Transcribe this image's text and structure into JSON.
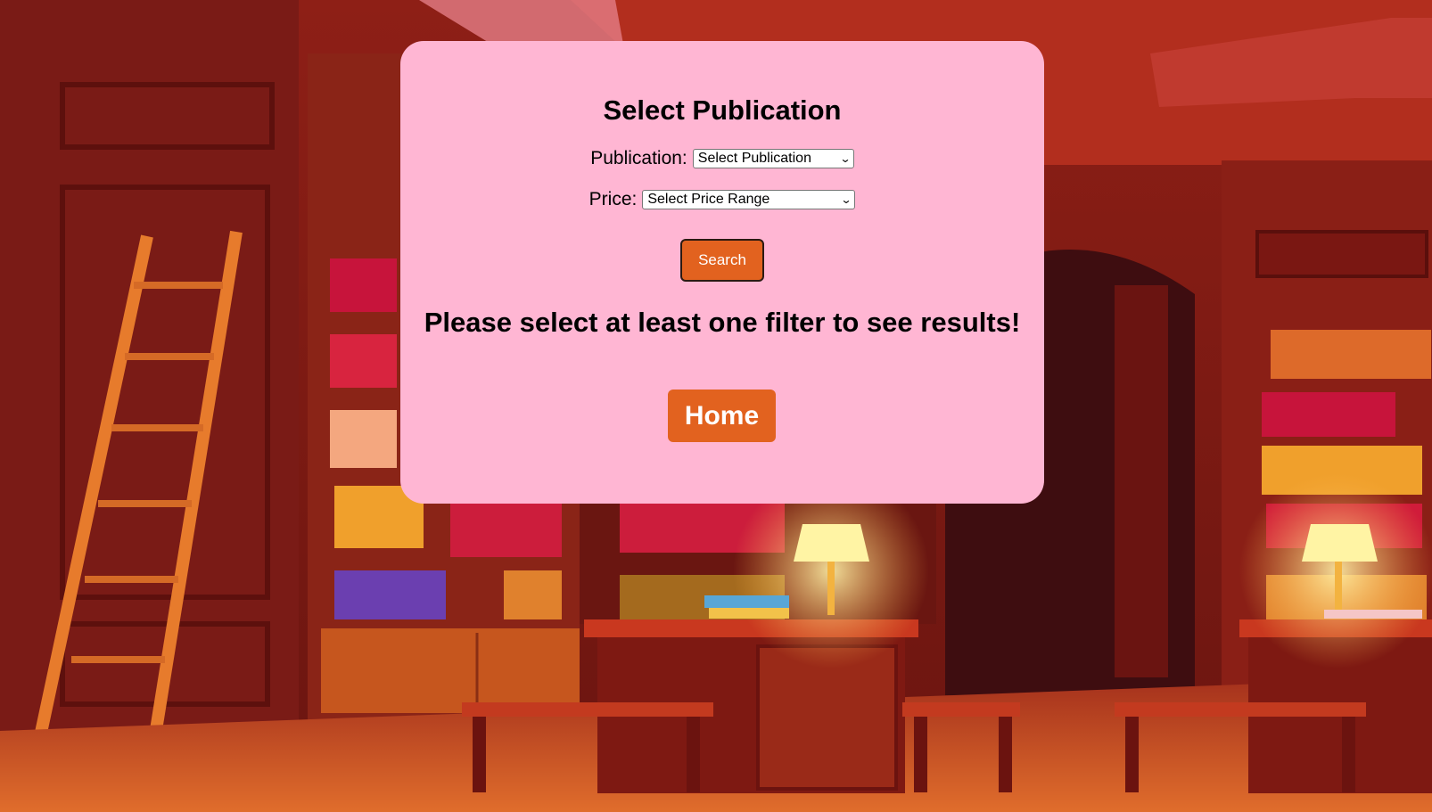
{
  "page": {
    "title": "Select Publication"
  },
  "filters": {
    "publication_label": "Publication:",
    "publication_selected": "Select Publication",
    "price_label": "Price:",
    "price_selected": "Select Price Range"
  },
  "actions": {
    "search_label": "Search",
    "home_label": "Home"
  },
  "message": "Please select at least one filter to see results!",
  "colors": {
    "card_background": "#ffb6d3",
    "button_orange": "#e2621f",
    "background_dominant": "#7a1a12"
  },
  "icons": {
    "dropdown": "chevron-down-icon"
  }
}
